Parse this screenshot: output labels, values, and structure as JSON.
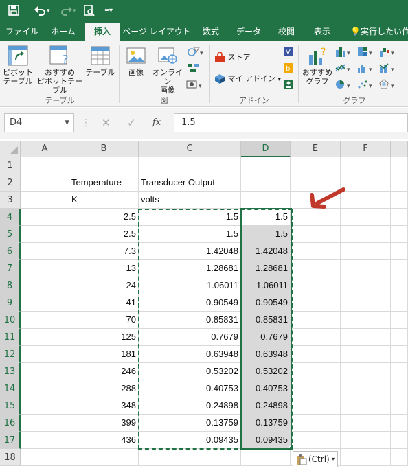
{
  "quick_access": {
    "save_icon": "save-icon",
    "undo_icon": "undo-icon",
    "redo_icon": "redo-icon",
    "preview_icon": "print-preview-icon",
    "more_icon": "customize-qat-icon"
  },
  "tabs": [
    {
      "label": "ファイル"
    },
    {
      "label": "ホーム"
    },
    {
      "label": "挿入",
      "active": true
    },
    {
      "label": "ページ レイアウト"
    },
    {
      "label": "数式"
    },
    {
      "label": "データ"
    },
    {
      "label": "校閲"
    },
    {
      "label": "表示"
    },
    {
      "label": "実行したい作"
    }
  ],
  "ribbon": {
    "tables_group": {
      "label": "テーブル",
      "pivot": "ピボット\nテーブル",
      "pivot_line1": "ピボット",
      "pivot_line2": "テーブル",
      "recommended_line1": "おすすめ",
      "recommended_line2": "ピボットテーブル",
      "table": "テーブル"
    },
    "illustrations_group": {
      "label": "図",
      "picture": "画像",
      "online_line1": "オンライン",
      "online_line2": "画像"
    },
    "addins_group": {
      "label": "アドイン",
      "store": "ストア",
      "my_addins": "マイ アドイン"
    },
    "charts_group": {
      "label": "グラフ",
      "recommended_line1": "おすすめ",
      "recommended_line2": "グラフ"
    }
  },
  "formula_bar": {
    "name_box": "D4",
    "cancel_icon": "✕",
    "enter_icon": "✓",
    "fx": "fx",
    "value": "1.5"
  },
  "sheet": {
    "columns": [
      "A",
      "B",
      "C",
      "D",
      "E",
      "F"
    ],
    "selected_column": "D",
    "rows": [
      {
        "n": "1",
        "B": "",
        "C": "",
        "D": ""
      },
      {
        "n": "2",
        "B": "Temperature",
        "C": "Transducer Output",
        "D": ""
      },
      {
        "n": "3",
        "B": "K",
        "C": "volts",
        "D": ""
      },
      {
        "n": "4",
        "B": "2.5",
        "C": "1.5",
        "D": "1.5"
      },
      {
        "n": "5",
        "B": "2.5",
        "C": "1.5",
        "D": "1.5"
      },
      {
        "n": "6",
        "B": "7.3",
        "C": "1.42048",
        "D": "1.42048"
      },
      {
        "n": "7",
        "B": "13",
        "C": "1.28681",
        "D": "1.28681"
      },
      {
        "n": "8",
        "B": "24",
        "C": "1.06011",
        "D": "1.06011"
      },
      {
        "n": "9",
        "B": "41",
        "C": "0.90549",
        "D": "0.90549"
      },
      {
        "n": "10",
        "B": "70",
        "C": "0.85831",
        "D": "0.85831"
      },
      {
        "n": "11",
        "B": "125",
        "C": "0.7679",
        "D": "0.7679"
      },
      {
        "n": "12",
        "B": "181",
        "C": "0.63948",
        "D": "0.63948"
      },
      {
        "n": "13",
        "B": "246",
        "C": "0.53202",
        "D": "0.53202"
      },
      {
        "n": "14",
        "B": "288",
        "C": "0.40753",
        "D": "0.40753"
      },
      {
        "n": "15",
        "B": "348",
        "C": "0.24898",
        "D": "0.24898"
      },
      {
        "n": "16",
        "B": "399",
        "C": "0.13759",
        "D": "0.13759"
      },
      {
        "n": "17",
        "B": "436",
        "C": "0.09435",
        "D": "0.09435"
      },
      {
        "n": "18",
        "B": "",
        "C": "",
        "D": ""
      }
    ]
  },
  "paste_options": {
    "label": "(Ctrl)",
    "icon": "clipboard-icon"
  },
  "colors": {
    "excel_green": "#217346",
    "arrow": "#c0392b",
    "selection_fill": "#d9d9d9"
  }
}
